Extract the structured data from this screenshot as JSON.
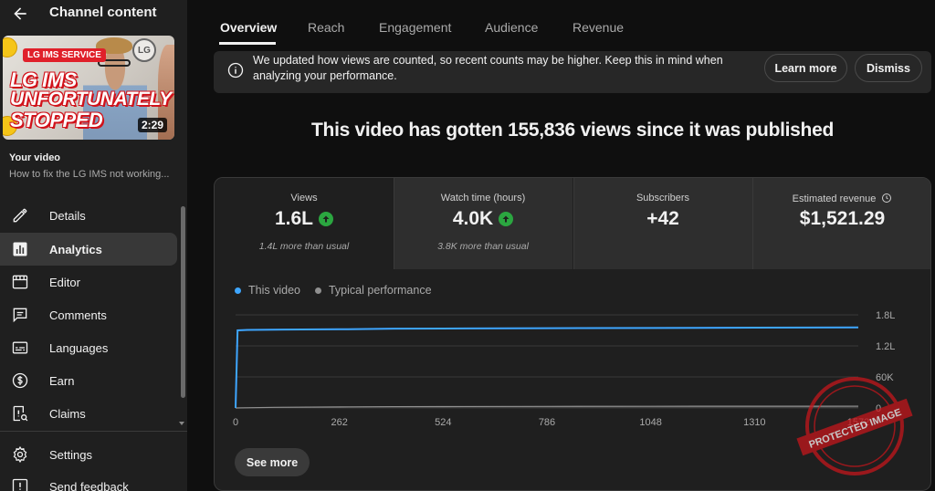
{
  "sidebar": {
    "title": "Channel content",
    "thumbnail": {
      "service_tag": "LG IMS SERVICE",
      "line1": "LG IMS",
      "line2": "UNFORTUNATELY",
      "line3": "STOPPED",
      "logo": "LG",
      "duration": "2:29"
    },
    "your_video_label": "Your video",
    "video_title": "How to fix the LG IMS not working...",
    "items": [
      {
        "label": "Details",
        "icon": "pencil-icon"
      },
      {
        "label": "Analytics",
        "icon": "analytics-icon"
      },
      {
        "label": "Editor",
        "icon": "editor-icon"
      },
      {
        "label": "Comments",
        "icon": "comments-icon"
      },
      {
        "label": "Languages",
        "icon": "subtitles-icon"
      },
      {
        "label": "Earn",
        "icon": "dollar-icon"
      },
      {
        "label": "Claims",
        "icon": "claims-icon"
      },
      {
        "label": "Settings",
        "icon": "gear-icon"
      },
      {
        "label": "Send feedback",
        "icon": "feedback-icon"
      }
    ]
  },
  "tabs": [
    "Overview",
    "Reach",
    "Engagement",
    "Audience",
    "Revenue"
  ],
  "banner": {
    "message": "We updated how views are counted, so recent counts may be higher. Keep this in mind when analyzing your performance.",
    "learn_more": "Learn more",
    "dismiss": "Dismiss"
  },
  "headline": "This video has gotten 155,836 views since it was published",
  "metrics": [
    {
      "label": "Views",
      "value": "1.6L",
      "sub": "1.4L more than usual",
      "up": true
    },
    {
      "label": "Watch time (hours)",
      "value": "4.0K",
      "sub": "3.8K more than usual",
      "up": true
    },
    {
      "label": "Subscribers",
      "value": "+42",
      "sub": "",
      "up": false
    },
    {
      "label": "Estimated revenue",
      "value": "$1,521.29",
      "sub": "",
      "up": false
    }
  ],
  "see_more": "See more",
  "watermark_text": "PROTECTED IMAGE",
  "colors": {
    "this_video": "#3ea6ff",
    "typical": "#909090",
    "up_green": "#2ba640"
  },
  "chart_data": {
    "type": "line",
    "x_ticks": [
      "0",
      "262",
      "524",
      "786",
      "1048",
      "1310",
      "1572"
    ],
    "y_ticks": [
      "1.8L",
      "1.2L",
      "60K",
      "0"
    ],
    "xlim": [
      0,
      1572
    ],
    "legend_placement": "top-left",
    "series": [
      {
        "name": "This video",
        "x": [
          0,
          5,
          30,
          60,
          120,
          262,
          400,
          524,
          786,
          1048,
          1310,
          1572
        ],
        "y": [
          0,
          150000,
          150800,
          151200,
          151600,
          152100,
          153200,
          153600,
          154200,
          154700,
          155200,
          155836
        ]
      },
      {
        "name": "Typical performance",
        "x": [
          0,
          100,
          262,
          400,
          524,
          786,
          1048,
          1310,
          1572
        ],
        "y": [
          0,
          1200,
          2000,
          2500,
          2700,
          3000,
          3200,
          3300,
          3400
        ]
      }
    ]
  }
}
